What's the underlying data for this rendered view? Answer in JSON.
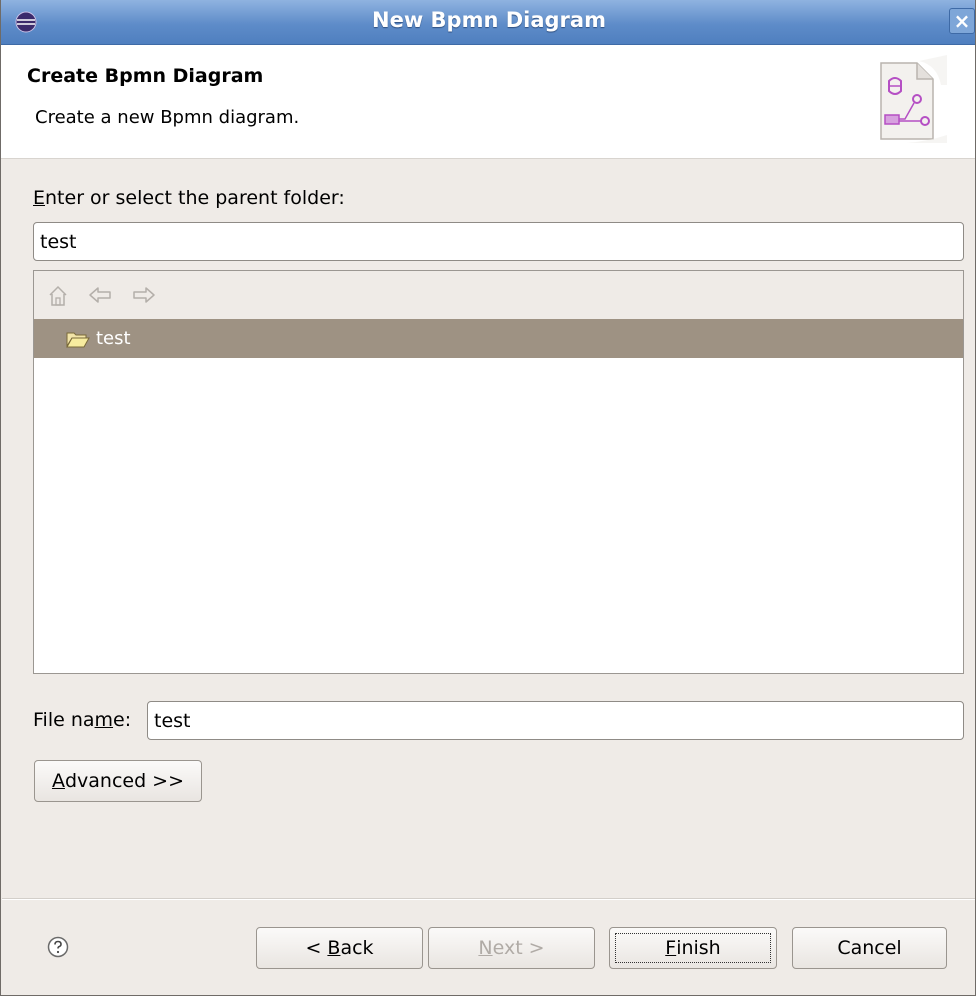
{
  "window": {
    "title": "New Bpmn Diagram",
    "close_glyph": "×"
  },
  "banner": {
    "heading": "Create Bpmn Diagram",
    "description": "Create a new Bpmn diagram.",
    "icon": "bpmn-wizard-icon"
  },
  "folder": {
    "label_mnemonic": "E",
    "label_rest": "nter or select the parent folder:",
    "value": "test",
    "tree": {
      "toolbar_icons": [
        "home-icon",
        "back-arrow-icon",
        "forward-arrow-icon"
      ],
      "items": [
        {
          "label": "test",
          "icon": "folder-open-icon",
          "selected": true
        }
      ]
    }
  },
  "file_name": {
    "label_pre": "File na",
    "label_mnemonic": "m",
    "label_post": "e:",
    "value": "test"
  },
  "advanced": {
    "mnemonic": "A",
    "rest": "dvanced >>"
  },
  "buttons": {
    "back": {
      "pre": "< ",
      "mnemonic": "B",
      "rest": "ack"
    },
    "next": {
      "mnemonic": "N",
      "rest": "ext >"
    },
    "finish": {
      "mnemonic": "F",
      "rest": "inish"
    },
    "cancel": {
      "label": "Cancel"
    }
  },
  "colors": {
    "titlebar": "#5e8cc9",
    "selection": "#9e9283",
    "dialog_bg": "#efebe7"
  }
}
